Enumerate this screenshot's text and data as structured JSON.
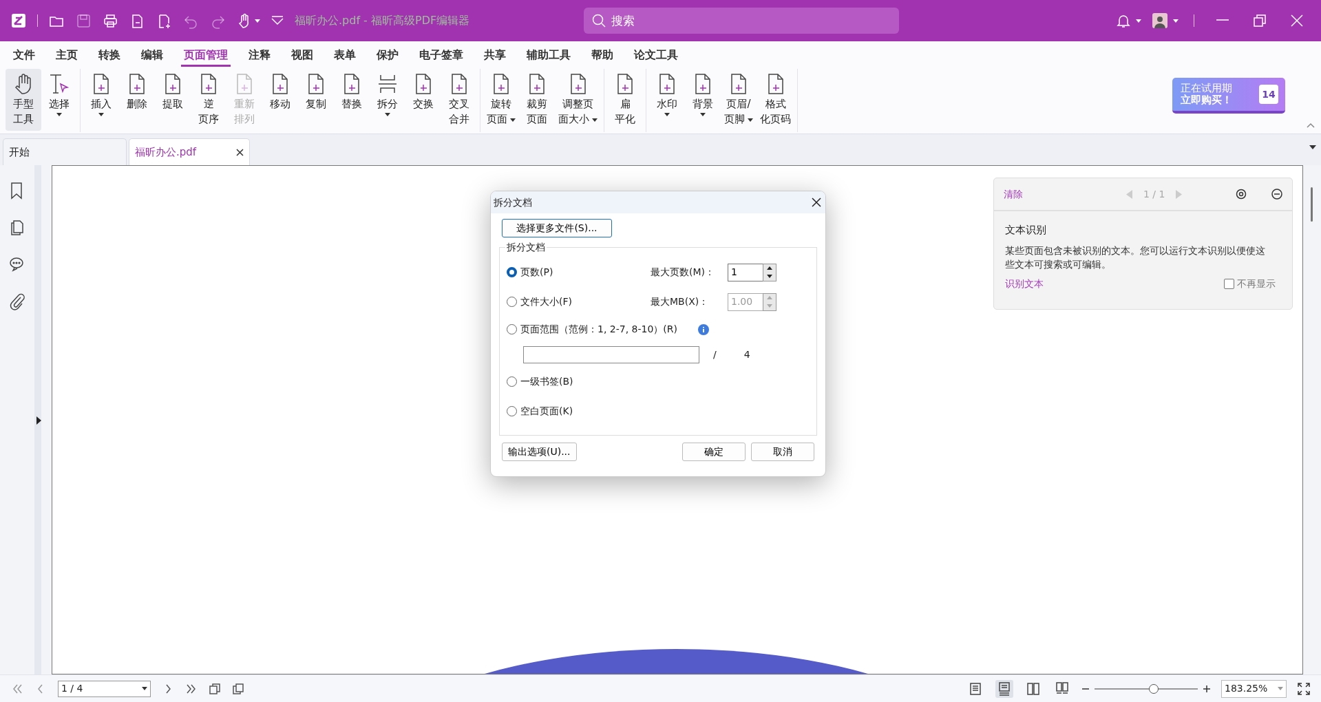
{
  "title_bar": {
    "title": "福昕办公.pdf - 福昕高级PDF编辑器",
    "search": {
      "placeholder": "搜索"
    }
  },
  "menu_tabs": [
    {
      "label": "文件",
      "selected": false
    },
    {
      "label": "主页",
      "selected": false
    },
    {
      "label": "转换",
      "selected": false
    },
    {
      "label": "编辑",
      "selected": false
    },
    {
      "label": "页面管理",
      "selected": true
    },
    {
      "label": "注释",
      "selected": false
    },
    {
      "label": "视图",
      "selected": false
    },
    {
      "label": "表单",
      "selected": false
    },
    {
      "label": "保护",
      "selected": false
    },
    {
      "label": "电子签章",
      "selected": false
    },
    {
      "label": "共享",
      "selected": false
    },
    {
      "label": "辅助工具",
      "selected": false
    },
    {
      "label": "帮助",
      "selected": false
    },
    {
      "label": "论文工具",
      "selected": false
    }
  ],
  "ribbon_groups": [
    {
      "items": [
        {
          "lines": [
            "手型",
            "工具"
          ],
          "kind": "hand",
          "dropdown": false,
          "disabled": false,
          "selected": true
        },
        {
          "lines": [
            "选择"
          ],
          "kind": "select",
          "dropdown": true,
          "disabled": false,
          "selected": false
        }
      ]
    },
    {
      "items": [
        {
          "lines": [
            "插入"
          ],
          "kind": "page",
          "dropdown": true,
          "disabled": false,
          "selected": false
        },
        {
          "lines": [
            "删除"
          ],
          "kind": "page",
          "dropdown": false,
          "disabled": false,
          "selected": false
        },
        {
          "lines": [
            "提取"
          ],
          "kind": "page",
          "dropdown": false,
          "disabled": false,
          "selected": false
        },
        {
          "lines": [
            "逆",
            "页序"
          ],
          "kind": "page",
          "dropdown": false,
          "disabled": false,
          "selected": false
        },
        {
          "lines": [
            "重新",
            "排列"
          ],
          "kind": "page",
          "dropdown": false,
          "disabled": true,
          "selected": false
        },
        {
          "lines": [
            "移动"
          ],
          "kind": "page",
          "dropdown": false,
          "disabled": false,
          "selected": false
        },
        {
          "lines": [
            "复制"
          ],
          "kind": "page",
          "dropdown": false,
          "disabled": false,
          "selected": false
        },
        {
          "lines": [
            "替换"
          ],
          "kind": "page",
          "dropdown": false,
          "disabled": false,
          "selected": false
        },
        {
          "lines": [
            "拆分"
          ],
          "kind": "split",
          "dropdown": true,
          "disabled": false,
          "selected": false
        },
        {
          "lines": [
            "交换"
          ],
          "kind": "page",
          "dropdown": false,
          "disabled": false,
          "selected": false
        },
        {
          "lines": [
            "交叉",
            "合并"
          ],
          "kind": "page",
          "dropdown": false,
          "disabled": false,
          "selected": false
        }
      ]
    },
    {
      "items": [
        {
          "lines": [
            "旋转",
            "页面"
          ],
          "kind": "page",
          "dropdown": true,
          "disabled": false,
          "selected": false
        },
        {
          "lines": [
            "裁剪",
            "页面"
          ],
          "kind": "page",
          "dropdown": false,
          "disabled": false,
          "selected": false
        },
        {
          "lines": [
            "调整页",
            "面大小"
          ],
          "kind": "page",
          "dropdown": true,
          "disabled": false,
          "selected": false
        }
      ]
    },
    {
      "items": [
        {
          "lines": [
            "扁",
            "平化"
          ],
          "kind": "page",
          "dropdown": false,
          "disabled": false,
          "selected": false
        }
      ]
    },
    {
      "items": [
        {
          "lines": [
            "水印"
          ],
          "kind": "page",
          "dropdown": true,
          "disabled": false,
          "selected": false
        },
        {
          "lines": [
            "背景"
          ],
          "kind": "page",
          "dropdown": true,
          "disabled": false,
          "selected": false
        },
        {
          "lines": [
            "页眉/",
            "页脚"
          ],
          "kind": "page",
          "dropdown": true,
          "disabled": false,
          "selected": false
        },
        {
          "lines": [
            "格式",
            "化页码"
          ],
          "kind": "page",
          "dropdown": false,
          "disabled": false,
          "selected": false
        }
      ]
    }
  ],
  "trial_badge": {
    "line_1": "正在试用期",
    "line_2": "立即购买！",
    "days": "14"
  },
  "doc_tabs": [
    {
      "label": "开始",
      "selected": false,
      "closable": false
    },
    {
      "label": "福昕办公.pdf",
      "selected": true,
      "closable": true
    }
  ],
  "dialog": {
    "title": "拆分文档",
    "choose_button": "选择更多文件(S)...",
    "group_title": "拆分文档",
    "options": [
      {
        "label": "页数(P)",
        "selected": true,
        "setting": {
          "label": "最大页数(M)：",
          "value": "1",
          "disabled": false
        }
      },
      {
        "label": "文件大小(F)",
        "selected": false,
        "setting": {
          "label": "最大MB(X)：",
          "value": "1.00",
          "disabled": true
        }
      },
      {
        "label": "页面范围（范例：1, 2-7, 8-10）(R)",
        "selected": false,
        "info": true,
        "range": {
          "separator": "/",
          "total": "4"
        }
      },
      {
        "label": "一级书签(B)",
        "selected": false
      },
      {
        "label": "空白页面(K)",
        "selected": false
      }
    ],
    "buttons": {
      "output": "输出选项(U)...",
      "ok": "确定",
      "cancel": "取消"
    }
  },
  "ocr_panel": {
    "clear": "清除",
    "pager": "1 / 1",
    "title": "文本识别",
    "message": "某些页面包含未被识别的文本。您可以运行文本识别以便使这些文本可搜索或可编辑。",
    "action": "识别文本",
    "dont_show": {
      "label": "不再显示",
      "checked": false
    }
  },
  "status_bar": {
    "page": "1 / 4",
    "view_modes": [
      {
        "kind": "single",
        "selected": false
      },
      {
        "kind": "continuous",
        "selected": true
      },
      {
        "kind": "facing",
        "selected": false
      },
      {
        "kind": "facing-continuous",
        "selected": false
      }
    ],
    "zoom": {
      "level": 0.57,
      "value": "183.25%"
    }
  }
}
